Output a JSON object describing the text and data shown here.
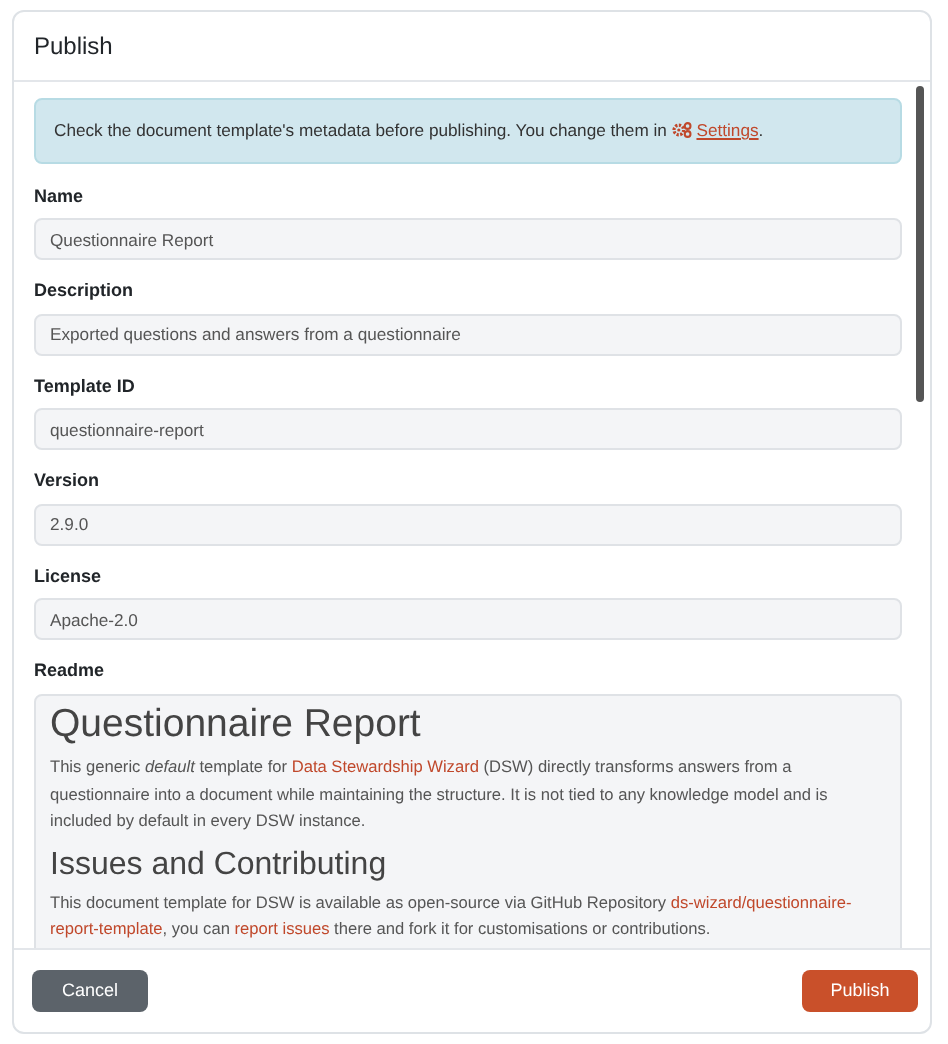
{
  "dialog": {
    "title": "Publish"
  },
  "alert": {
    "text": "Check the document template's metadata before publishing. You change them in",
    "link": "Settings",
    "end": "."
  },
  "fields": [
    {
      "label": "Name",
      "value": "Questionnaire Report"
    },
    {
      "label": "Description",
      "value": "Exported questions and answers from a questionnaire"
    },
    {
      "label": "Template ID",
      "value": "questionnaire-report"
    },
    {
      "label": "Version",
      "value": "2.9.0"
    },
    {
      "label": "License",
      "value": "Apache-2.0"
    }
  ],
  "readme": {
    "label": "Readme",
    "blocks": [
      {
        "kind": "heading",
        "text": "Questionnaire Report"
      },
      {
        "kind": "paragraph",
        "parts": [
          {
            "kind": "text",
            "text": "This generic *default* template for "
          },
          {
            "kind": "link",
            "text": "Data Stewardship Wizard"
          },
          {
            "kind": "text",
            "text": " (DSW) directly transforms answers from a questionnaire into a document while maintaining the structure. It is not tied to any knowledge model and is included by default in every DSW instance."
          }
        ]
      },
      {
        "kind": "heading",
        "text": "Issues and Contributing"
      },
      {
        "kind": "paragraph",
        "parts": [
          {
            "kind": "text",
            "text": "This document template for DSW is available as open-source via GitHub Repository "
          },
          {
            "kind": "link",
            "text": "ds-wizard/questionnaire-"
          },
          {
            "kind": "link",
            "text": "report-template"
          },
          {
            "kind": "text",
            "text": ", you can "
          },
          {
            "kind": "link",
            "text": "report issues"
          },
          {
            "kind": "text",
            "text": " there and fork it for customisations or contributions."
          }
        ]
      }
    ]
  },
  "buttons": [
    {
      "label": "Cancel",
      "kind": "secondary"
    },
    {
      "label": "Publish",
      "kind": "primary"
    }
  ]
}
